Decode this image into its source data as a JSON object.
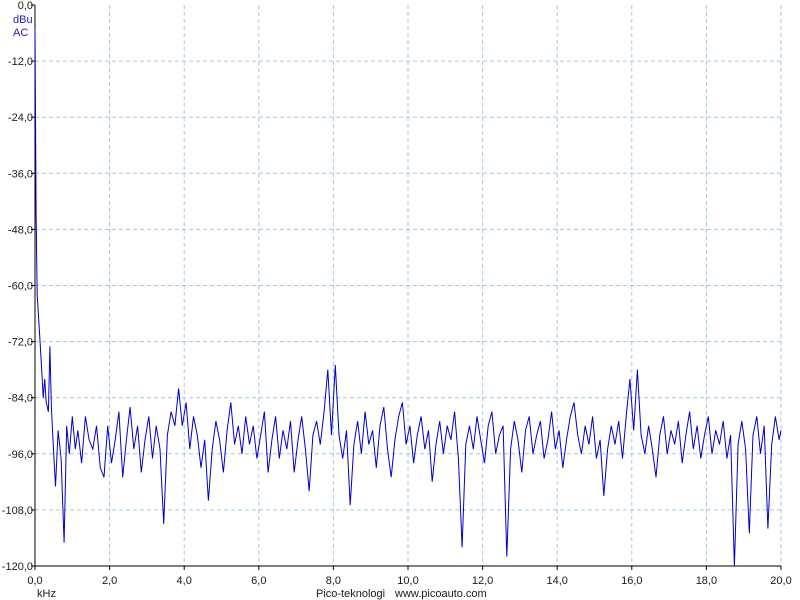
{
  "chart_data": {
    "type": "line",
    "y_unit": "dBu",
    "y_mode": "AC",
    "x_unit": "kHz",
    "footer_brand": "Pico-teknologi",
    "footer_url": "www.picoauto.com",
    "xlim": [
      0,
      20
    ],
    "ylim": [
      -120,
      0
    ],
    "x_ticks": [
      "0,0",
      "2,0",
      "4,0",
      "6,0",
      "8,0",
      "10,0",
      "12,0",
      "14,0",
      "16,0",
      "18,0",
      "20,0"
    ],
    "y_ticks": [
      "0,0",
      "-12,0",
      "-24,0",
      "-36,0",
      "-48,0",
      "-60,0",
      "-72,0",
      "-84,0",
      "-96,0",
      "-108,0",
      "-120,0"
    ],
    "grid": true,
    "colors": {
      "trace": "#0000cc",
      "grid": "#9fc9e6",
      "axis": "#000000"
    },
    "series": [
      {
        "points": [
          [
            0.0,
            -5
          ],
          [
            0.03,
            -45
          ],
          [
            0.06,
            -62
          ],
          [
            0.12,
            -70
          ],
          [
            0.18,
            -78
          ],
          [
            0.22,
            -84
          ],
          [
            0.26,
            -80
          ],
          [
            0.3,
            -85
          ],
          [
            0.36,
            -87
          ],
          [
            0.4,
            -73
          ],
          [
            0.44,
            -86
          ],
          [
            0.5,
            -96
          ],
          [
            0.55,
            -103
          ],
          [
            0.62,
            -91
          ],
          [
            0.7,
            -97
          ],
          [
            0.78,
            -115
          ],
          [
            0.85,
            -90
          ],
          [
            0.92,
            -96
          ],
          [
            1.0,
            -88
          ],
          [
            1.08,
            -95
          ],
          [
            1.15,
            -91
          ],
          [
            1.25,
            -98
          ],
          [
            1.35,
            -88
          ],
          [
            1.45,
            -93
          ],
          [
            1.55,
            -95
          ],
          [
            1.65,
            -90
          ],
          [
            1.75,
            -99
          ],
          [
            1.85,
            -101
          ],
          [
            1.95,
            -90
          ],
          [
            2.05,
            -98
          ],
          [
            2.15,
            -93
          ],
          [
            2.25,
            -87
          ],
          [
            2.35,
            -101
          ],
          [
            2.45,
            -93
          ],
          [
            2.55,
            -86
          ],
          [
            2.65,
            -95
          ],
          [
            2.75,
            -90
          ],
          [
            2.85,
            -100
          ],
          [
            2.95,
            -93
          ],
          [
            3.05,
            -88
          ],
          [
            3.15,
            -97
          ],
          [
            3.25,
            -90
          ],
          [
            3.35,
            -95
          ],
          [
            3.45,
            -111
          ],
          [
            3.55,
            -92
          ],
          [
            3.65,
            -87
          ],
          [
            3.75,
            -90
          ],
          [
            3.85,
            -82
          ],
          [
            3.95,
            -90
          ],
          [
            4.05,
            -85
          ],
          [
            4.15,
            -95
          ],
          [
            4.25,
            -88
          ],
          [
            4.35,
            -92
          ],
          [
            4.45,
            -99
          ],
          [
            4.55,
            -93
          ],
          [
            4.65,
            -106
          ],
          [
            4.75,
            -95
          ],
          [
            4.85,
            -89
          ],
          [
            4.95,
            -93
          ],
          [
            5.05,
            -100
          ],
          [
            5.15,
            -91
          ],
          [
            5.25,
            -85
          ],
          [
            5.35,
            -94
          ],
          [
            5.45,
            -90
          ],
          [
            5.55,
            -96
          ],
          [
            5.65,
            -88
          ],
          [
            5.75,
            -94
          ],
          [
            5.85,
            -90
          ],
          [
            5.95,
            -97
          ],
          [
            6.05,
            -92
          ],
          [
            6.15,
            -87
          ],
          [
            6.25,
            -100
          ],
          [
            6.35,
            -93
          ],
          [
            6.45,
            -88
          ],
          [
            6.55,
            -97
          ],
          [
            6.65,
            -91
          ],
          [
            6.75,
            -95
          ],
          [
            6.85,
            -89
          ],
          [
            6.95,
            -100
          ],
          [
            7.05,
            -93
          ],
          [
            7.15,
            -88
          ],
          [
            7.25,
            -95
          ],
          [
            7.35,
            -104
          ],
          [
            7.45,
            -92
          ],
          [
            7.55,
            -89
          ],
          [
            7.65,
            -94
          ],
          [
            7.75,
            -87
          ],
          [
            7.85,
            -78
          ],
          [
            7.95,
            -92
          ],
          [
            8.05,
            -77
          ],
          [
            8.15,
            -92
          ],
          [
            8.25,
            -97
          ],
          [
            8.35,
            -91
          ],
          [
            8.45,
            -107
          ],
          [
            8.55,
            -94
          ],
          [
            8.65,
            -89
          ],
          [
            8.75,
            -96
          ],
          [
            8.85,
            -87
          ],
          [
            8.95,
            -94
          ],
          [
            9.05,
            -91
          ],
          [
            9.15,
            -99
          ],
          [
            9.25,
            -90
          ],
          [
            9.35,
            -86
          ],
          [
            9.45,
            -95
          ],
          [
            9.55,
            -101
          ],
          [
            9.65,
            -93
          ],
          [
            9.75,
            -88
          ],
          [
            9.85,
            -85
          ],
          [
            9.95,
            -94
          ],
          [
            10.05,
            -90
          ],
          [
            10.15,
            -98
          ],
          [
            10.25,
            -92
          ],
          [
            10.35,
            -88
          ],
          [
            10.45,
            -95
          ],
          [
            10.55,
            -91
          ],
          [
            10.65,
            -102
          ],
          [
            10.75,
            -94
          ],
          [
            10.85,
            -89
          ],
          [
            10.95,
            -96
          ],
          [
            11.05,
            -90
          ],
          [
            11.15,
            -93
          ],
          [
            11.25,
            -87
          ],
          [
            11.35,
            -97
          ],
          [
            11.45,
            -116
          ],
          [
            11.55,
            -94
          ],
          [
            11.65,
            -90
          ],
          [
            11.75,
            -95
          ],
          [
            11.85,
            -88
          ],
          [
            11.95,
            -93
          ],
          [
            12.05,
            -98
          ],
          [
            12.15,
            -90
          ],
          [
            12.25,
            -87
          ],
          [
            12.35,
            -96
          ],
          [
            12.45,
            -92
          ],
          [
            12.55,
            -90
          ],
          [
            12.65,
            -118
          ],
          [
            12.75,
            -95
          ],
          [
            12.85,
            -89
          ],
          [
            12.95,
            -93
          ],
          [
            13.05,
            -100
          ],
          [
            13.15,
            -91
          ],
          [
            13.25,
            -88
          ],
          [
            13.35,
            -96
          ],
          [
            13.45,
            -92
          ],
          [
            13.55,
            -89
          ],
          [
            13.65,
            -97
          ],
          [
            13.75,
            -93
          ],
          [
            13.85,
            -87
          ],
          [
            13.95,
            -95
          ],
          [
            14.05,
            -91
          ],
          [
            14.15,
            -99
          ],
          [
            14.25,
            -93
          ],
          [
            14.35,
            -88
          ],
          [
            14.45,
            -85
          ],
          [
            14.55,
            -92
          ],
          [
            14.65,
            -96
          ],
          [
            14.75,
            -90
          ],
          [
            14.85,
            -94
          ],
          [
            14.95,
            -88
          ],
          [
            15.05,
            -97
          ],
          [
            15.15,
            -93
          ],
          [
            15.25,
            -105
          ],
          [
            15.35,
            -95
          ],
          [
            15.45,
            -90
          ],
          [
            15.55,
            -94
          ],
          [
            15.65,
            -89
          ],
          [
            15.75,
            -97
          ],
          [
            15.85,
            -88
          ],
          [
            15.95,
            -80
          ],
          [
            16.05,
            -91
          ],
          [
            16.15,
            -78
          ],
          [
            16.25,
            -92
          ],
          [
            16.35,
            -96
          ],
          [
            16.45,
            -90
          ],
          [
            16.55,
            -95
          ],
          [
            16.65,
            -101
          ],
          [
            16.75,
            -92
          ],
          [
            16.85,
            -88
          ],
          [
            16.95,
            -96
          ],
          [
            17.05,
            -91
          ],
          [
            17.15,
            -94
          ],
          [
            17.25,
            -89
          ],
          [
            17.35,
            -98
          ],
          [
            17.45,
            -92
          ],
          [
            17.55,
            -87
          ],
          [
            17.65,
            -95
          ],
          [
            17.75,
            -90
          ],
          [
            17.85,
            -97
          ],
          [
            17.95,
            -92
          ],
          [
            18.05,
            -88
          ],
          [
            18.15,
            -96
          ],
          [
            18.25,
            -91
          ],
          [
            18.35,
            -94
          ],
          [
            18.45,
            -89
          ],
          [
            18.55,
            -97
          ],
          [
            18.65,
            -92
          ],
          [
            18.75,
            -120
          ],
          [
            18.85,
            -94
          ],
          [
            18.95,
            -89
          ],
          [
            19.05,
            -95
          ],
          [
            19.15,
            -113
          ],
          [
            19.25,
            -92
          ],
          [
            19.35,
            -88
          ],
          [
            19.45,
            -96
          ],
          [
            19.55,
            -90
          ],
          [
            19.65,
            -112
          ],
          [
            19.75,
            -94
          ],
          [
            19.85,
            -88
          ],
          [
            19.95,
            -93
          ],
          [
            20.0,
            -91
          ]
        ]
      }
    ]
  }
}
